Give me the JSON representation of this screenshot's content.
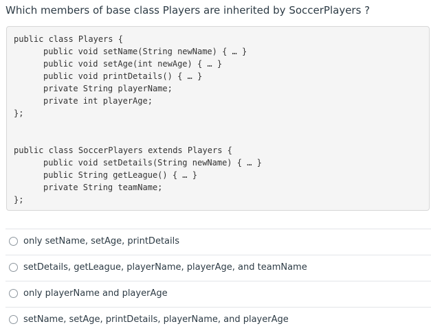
{
  "question": {
    "text": "Which members of base class Players are inherited by SoccerPlayers ?"
  },
  "code": {
    "lines": [
      "public class Players {",
      "public void setName(String newName) { … }",
      "public void setAge(int newAge) { … }",
      "public void printDetails() { … }",
      "private String playerName;",
      "private int playerAge;",
      "};",
      "public class SoccerPlayers extends Players {",
      "public void setDetails(String newName) { … }",
      "public String getLeague() { … }",
      "private String teamName;",
      "};"
    ]
  },
  "options": [
    {
      "label": "only setName, setAge, printDetails",
      "selected": false
    },
    {
      "label": "setDetails, getLeague, playerName, playerAge, and teamName",
      "selected": false
    },
    {
      "label": "only playerName and playerAge",
      "selected": false
    },
    {
      "label": "setName, setAge, printDetails, playerName, and playerAge",
      "selected": false
    }
  ]
}
